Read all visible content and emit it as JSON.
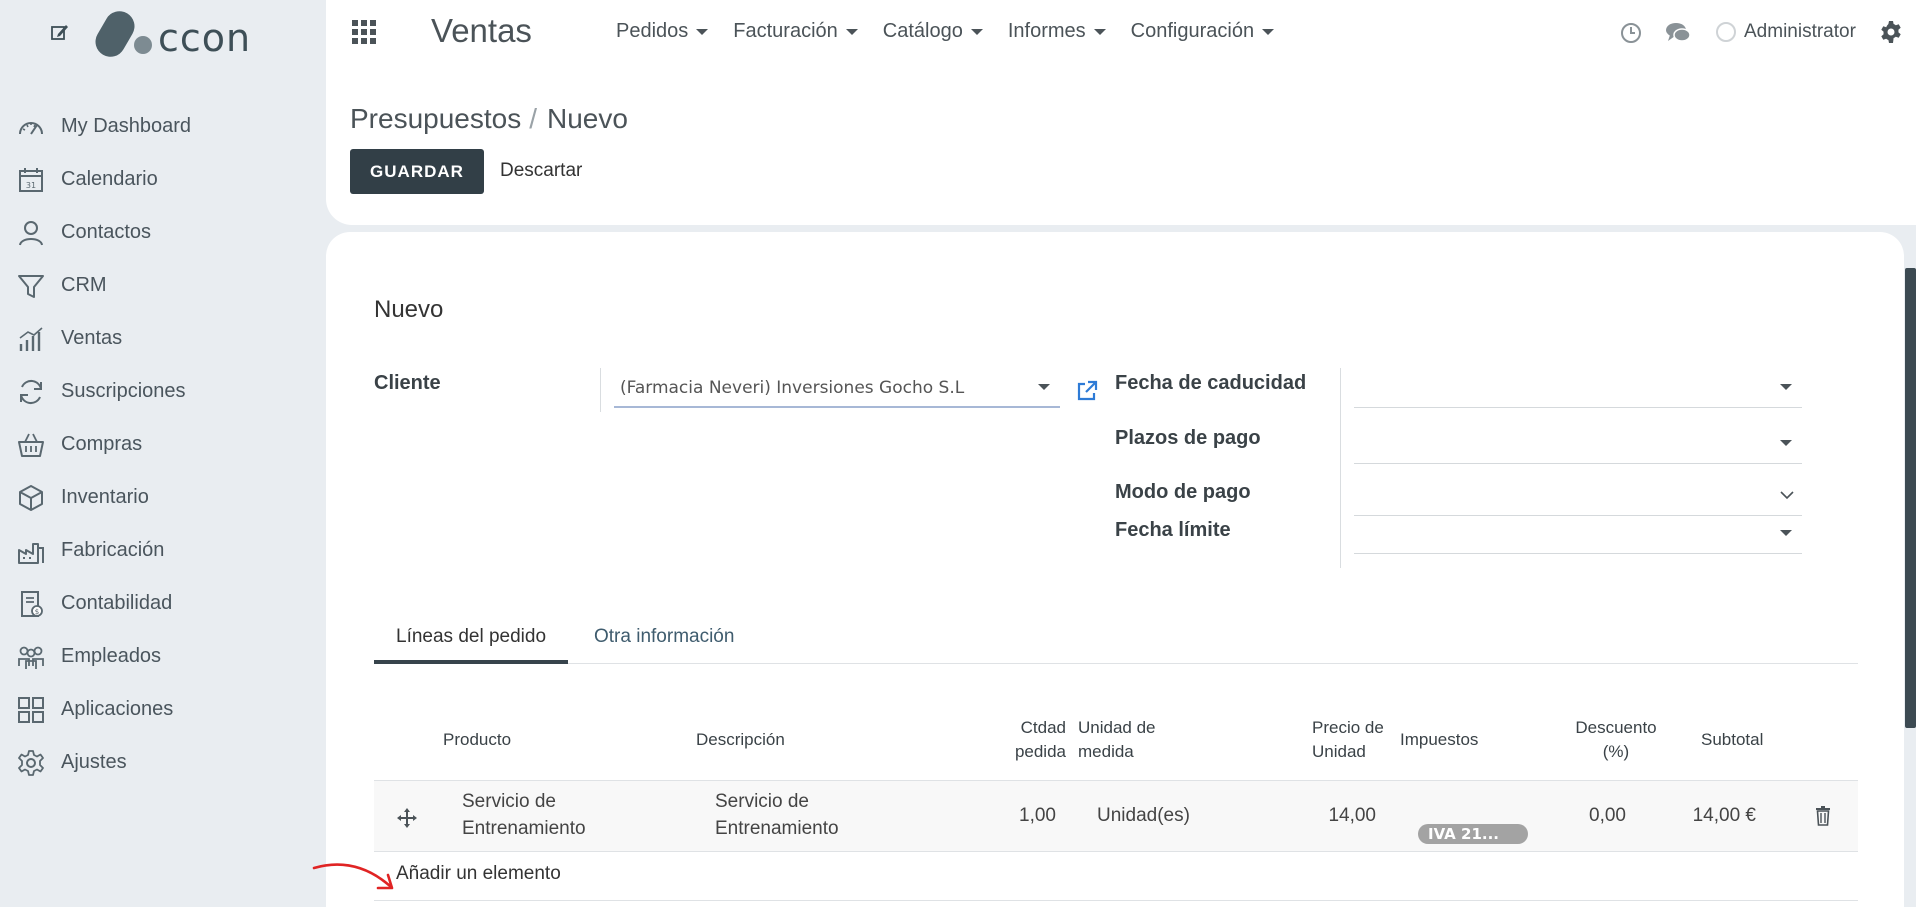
{
  "sidebar": {
    "logo_text": "ccon",
    "items": [
      {
        "label": "My Dashboard",
        "icon": "dashboard-icon"
      },
      {
        "label": "Calendario",
        "icon": "calendar-icon"
      },
      {
        "label": "Contactos",
        "icon": "user-icon"
      },
      {
        "label": "CRM",
        "icon": "funnel-icon"
      },
      {
        "label": "Ventas",
        "icon": "bar-chart-icon"
      },
      {
        "label": "Suscripciones",
        "icon": "refresh-icon"
      },
      {
        "label": "Compras",
        "icon": "basket-icon"
      },
      {
        "label": "Inventario",
        "icon": "box-icon"
      },
      {
        "label": "Fabricación",
        "icon": "factory-icon"
      },
      {
        "label": "Contabilidad",
        "icon": "invoice-icon"
      },
      {
        "label": "Empleados",
        "icon": "team-icon"
      },
      {
        "label": "Aplicaciones",
        "icon": "apps-grid-icon"
      },
      {
        "label": "Ajustes",
        "icon": "gear-icon"
      }
    ]
  },
  "topbar": {
    "app_title": "Ventas",
    "menu": [
      "Pedidos",
      "Facturación",
      "Catálogo",
      "Informes",
      "Configuración"
    ],
    "user": "Administrator"
  },
  "control": {
    "breadcrumb_parent": "Presupuestos",
    "breadcrumb_separator": "/",
    "breadcrumb_current": "Nuevo",
    "save_label": "GUARDAR",
    "discard_label": "Descartar"
  },
  "form": {
    "title": "Nuevo",
    "customer_label": "Cliente",
    "customer_value": "(Farmacia Neveri) Inversiones Gocho S.L",
    "expiry_label": "Fecha de caducidad",
    "expiry_value": "",
    "payment_terms_label": "Plazos de pago",
    "payment_terms_value": "",
    "payment_mode_label": "Modo de pago",
    "payment_mode_value": "",
    "deadline_label": "Fecha límite",
    "deadline_value": ""
  },
  "tabs": [
    {
      "label": "Líneas del pedido",
      "active": true
    },
    {
      "label": "Otra información",
      "active": false
    }
  ],
  "table": {
    "headers": {
      "product": "Producto",
      "description": "Descripción",
      "qty_1": "Ctdad",
      "qty_2": "pedida",
      "uom_1": "Unidad de",
      "uom_2": "medida",
      "price_1": "Precio de",
      "price_2": "Unidad",
      "taxes": "Impuestos",
      "discount_1": "Descuento",
      "discount_2": "(%)",
      "subtotal": "Subtotal"
    },
    "rows": [
      {
        "product_1": "Servicio de",
        "product_2": "Entrenamiento",
        "description_1": "Servicio de",
        "description_2": "Entrenamiento",
        "qty": "1,00",
        "uom": "Unidad(es)",
        "price": "14,00",
        "tax": "IVA 21...",
        "discount": "0,00",
        "subtotal": "14,00 €"
      }
    ],
    "add_line": "Añadir un elemento"
  },
  "colors": {
    "primary_button": "#323f47",
    "annotation_arrow": "#e02424",
    "link": "#3f5c6e"
  }
}
